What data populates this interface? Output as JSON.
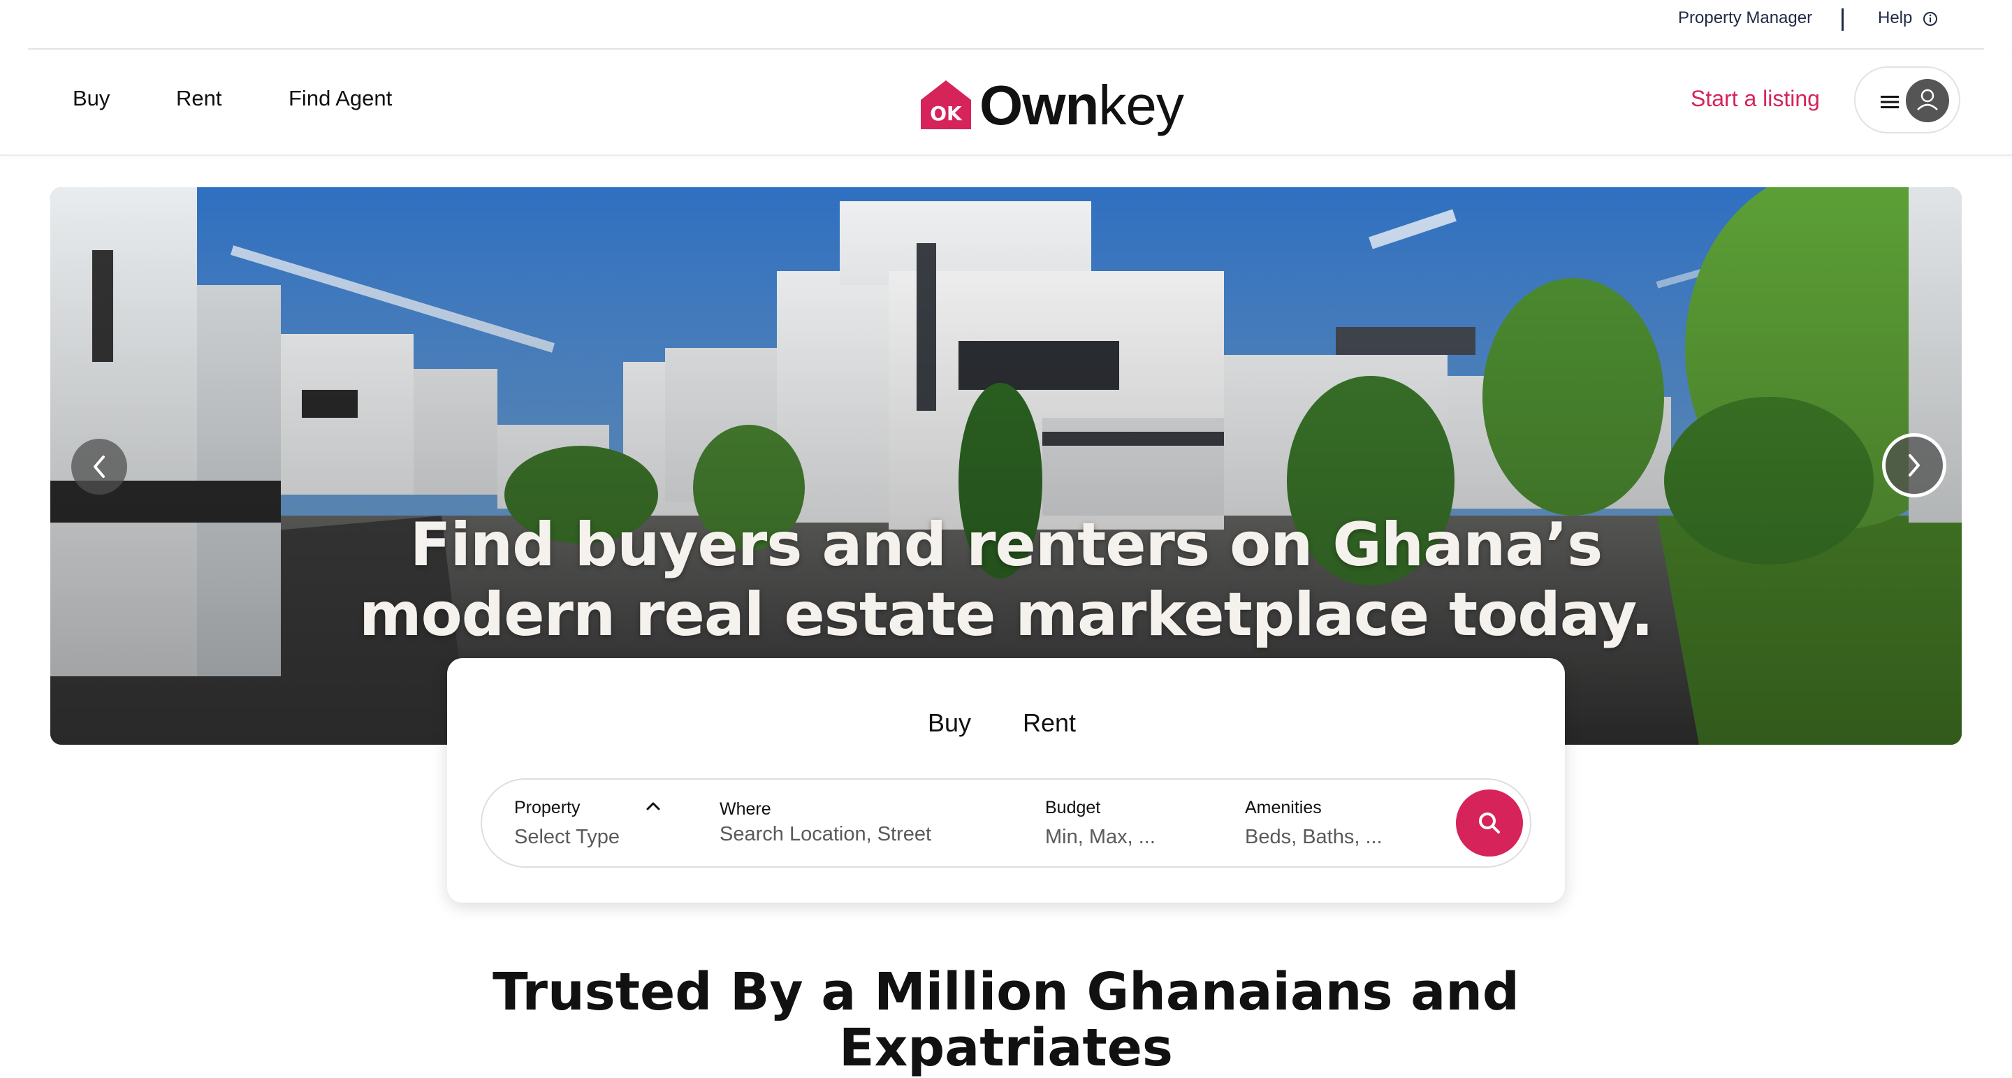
{
  "utility_bar": {
    "property_manager": "Property Manager",
    "help": "Help"
  },
  "header": {
    "nav": [
      "Buy",
      "Rent",
      "Find Agent"
    ],
    "logo": {
      "badge": "OK",
      "own": "Own",
      "key": "key",
      "brand_color": "#d6245a"
    },
    "start_listing": "Start a listing",
    "menu_icon": "hamburger-icon",
    "avatar_icon": "user-icon"
  },
  "hero": {
    "title_line1": "Find buyers and renters on Ghana’s",
    "title_line2": "modern real estate marketplace today.",
    "prev_icon": "chevron-left-icon",
    "next_icon": "chevron-right-icon"
  },
  "search": {
    "tabs": [
      "Buy",
      "Rent"
    ],
    "fields": {
      "property": {
        "label": "Property",
        "value": "Select Type"
      },
      "where": {
        "label": "Where",
        "placeholder": "Search Location, Street"
      },
      "budget": {
        "label": "Budget",
        "value": "Min, Max, ..."
      },
      "amenities": {
        "label": "Amenities",
        "value": "Beds, Baths, ..."
      }
    },
    "button_icon": "search-icon",
    "accent": "#d6245a"
  },
  "trust": {
    "heading_line1": "Trusted By a Million Ghanaians and",
    "heading_line2": "Expatriates"
  }
}
